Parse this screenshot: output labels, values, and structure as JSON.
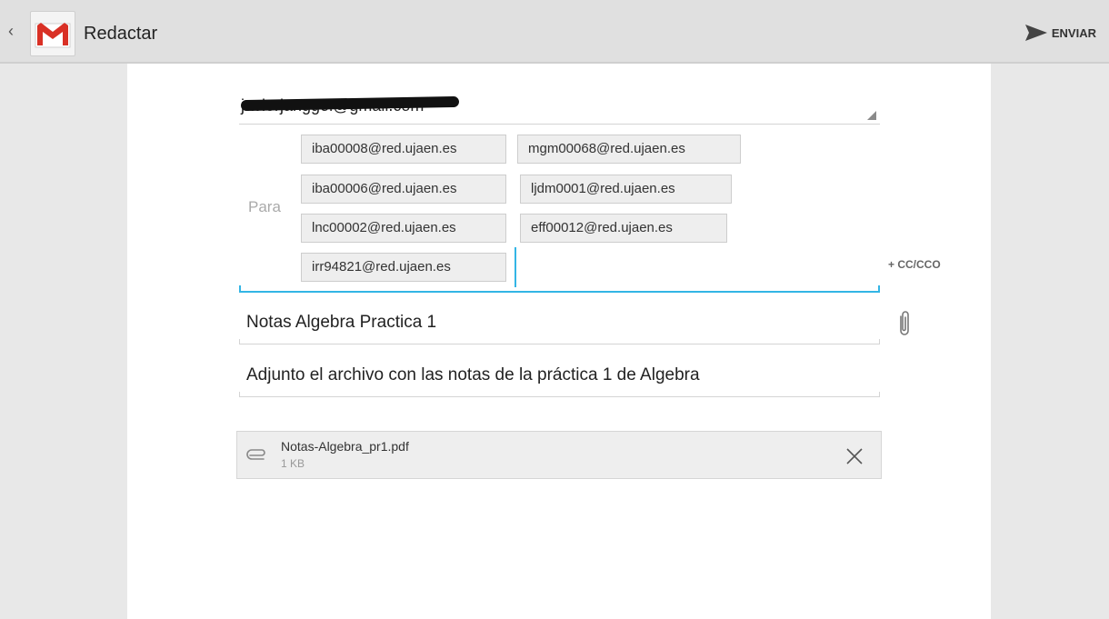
{
  "actionbar": {
    "title": "Redactar",
    "send_label": "ENVIAR"
  },
  "compose": {
    "from": "javierjanggel@gmail.com",
    "to_label": "Para",
    "recipients": [
      "iba00008@red.ujaen.es",
      "mgm00068@red.ujaen.es",
      "iba00006@red.ujaen.es",
      "ljdm0001@red.ujaen.es",
      "lnc00002@red.ujaen.es",
      "eff00012@red.ujaen.es",
      "irr94821@red.ujaen.es"
    ],
    "cc_label": "+ CC/CCO",
    "subject": "Notas Algebra Practica 1",
    "body": "Adjunto el archivo con las notas de la práctica 1 de Algebra",
    "attachment": {
      "name": "Notas-Algebra_pr1.pdf",
      "size": "1 KB"
    }
  },
  "colors": {
    "accent": "#33b5e5",
    "gmail_red": "#d93025"
  }
}
